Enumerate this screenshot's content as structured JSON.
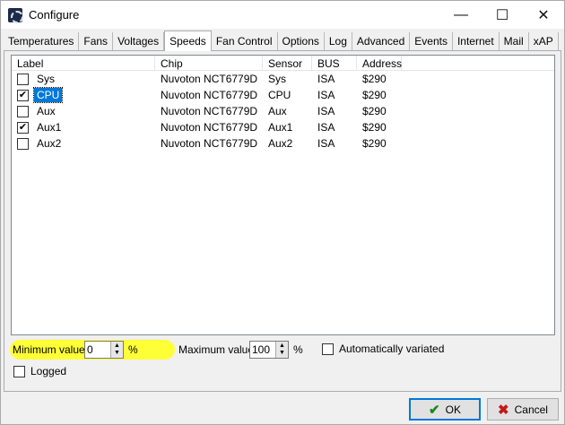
{
  "window": {
    "title": "Configure"
  },
  "title_buttons": {
    "minimize": "—",
    "maximize": "☐",
    "close": "✕"
  },
  "tabs": [
    {
      "label": "Temperatures"
    },
    {
      "label": "Fans"
    },
    {
      "label": "Voltages"
    },
    {
      "label": "Speeds",
      "active": true
    },
    {
      "label": "Fan Control"
    },
    {
      "label": "Options"
    },
    {
      "label": "Log"
    },
    {
      "label": "Advanced"
    },
    {
      "label": "Events"
    },
    {
      "label": "Internet"
    },
    {
      "label": "Mail"
    },
    {
      "label": "xAP"
    }
  ],
  "list": {
    "columns": {
      "label": "Label",
      "chip": "Chip",
      "sensor": "Sensor",
      "bus": "BUS",
      "address": "Address"
    },
    "rows": [
      {
        "checked": false,
        "label": "Sys",
        "chip": "Nuvoton NCT6779D",
        "sensor": "Sys",
        "bus": "ISA",
        "address": "$290",
        "selected": false
      },
      {
        "checked": true,
        "label": "CPU",
        "chip": "Nuvoton NCT6779D",
        "sensor": "CPU",
        "bus": "ISA",
        "address": "$290",
        "selected": true
      },
      {
        "checked": false,
        "label": "Aux",
        "chip": "Nuvoton NCT6779D",
        "sensor": "Aux",
        "bus": "ISA",
        "address": "$290",
        "selected": false
      },
      {
        "checked": true,
        "label": "Aux1",
        "chip": "Nuvoton NCT6779D",
        "sensor": "Aux1",
        "bus": "ISA",
        "address": "$290",
        "selected": false
      },
      {
        "checked": false,
        "label": "Aux2",
        "chip": "Nuvoton NCT6779D",
        "sensor": "Aux2",
        "bus": "ISA",
        "address": "$290",
        "selected": false
      }
    ]
  },
  "options": {
    "min_label": "Minimum value",
    "min_value": "0",
    "min_unit": "%",
    "max_label": "Maximum value",
    "max_value": "100",
    "max_unit": "%",
    "auto_label": "Automatically variated",
    "auto_checked": false,
    "logged_label": "Logged",
    "logged_checked": false
  },
  "buttons": {
    "ok": "OK",
    "cancel": "Cancel"
  },
  "colors": {
    "highlight": "#ffff38",
    "selection": "#0078d7",
    "ok_icon": "#1a8a1a",
    "cancel_icon": "#c41a1a"
  }
}
